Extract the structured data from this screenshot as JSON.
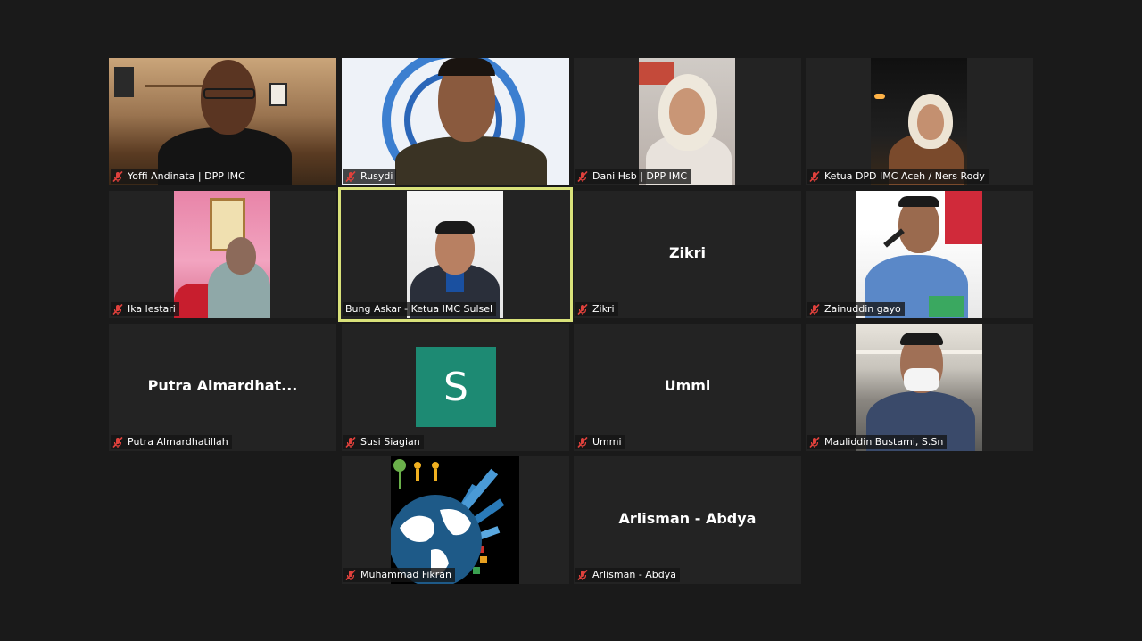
{
  "meeting": {
    "participants": [
      {
        "name": "Yoffi Andinata | DPP IMC",
        "muted": true,
        "video": true
      },
      {
        "name": "Rusydi",
        "muted": true,
        "video": true
      },
      {
        "name": "Dani Hsb | DPP IMC",
        "muted": true,
        "video": true
      },
      {
        "name": "Ketua DPD IMC Aceh / Ners Rody",
        "muted": true,
        "video": true
      },
      {
        "name": "Ika lestari",
        "muted": true,
        "video": true
      },
      {
        "name": "Bung Askar - Ketua IMC Sulsel",
        "muted": false,
        "video": true,
        "active_speaker": true
      },
      {
        "name": "Zikri",
        "display": "Zikri",
        "muted": true,
        "video": false
      },
      {
        "name": "Zainuddin gayo",
        "muted": true,
        "video": true
      },
      {
        "name": "Putra Almardhatillah",
        "display": "Putra  Almardhat...",
        "muted": true,
        "video": false
      },
      {
        "name": "Susi Siagian",
        "avatar_letter": "S",
        "muted": true,
        "video": false
      },
      {
        "name": "Ummi",
        "display": "Ummi",
        "muted": true,
        "video": false
      },
      {
        "name": "Mauliddin Bustami, S.Sn",
        "muted": true,
        "video": true
      },
      {
        "name": "Muhammad Fikran",
        "muted": true,
        "video": true
      },
      {
        "name": "Arlisman - Abdya",
        "display": "Arlisman - Abdya",
        "muted": true,
        "video": false
      }
    ],
    "icons": {
      "muted": "mic-muted-icon"
    },
    "colors": {
      "background": "#1a1a1a",
      "tile": "#232323",
      "active_border": "#d9e27a",
      "muted_icon": "#e0413c",
      "avatar": "#1d8a73"
    }
  }
}
